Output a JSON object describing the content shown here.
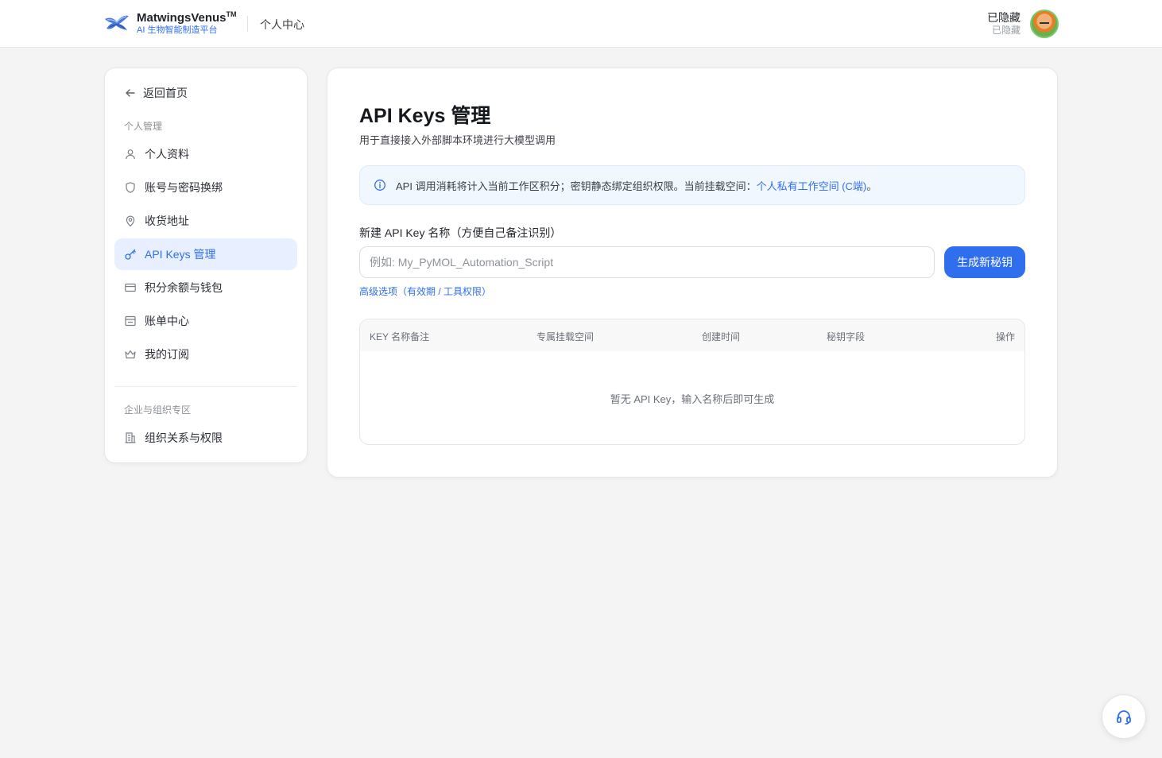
{
  "header": {
    "brand_name": "MatwingsVenus",
    "brand_tm": "TM",
    "brand_sub": "AI 生物智能制造平台",
    "section": "个人中心",
    "user_name": "已隐藏",
    "user_sub": "已隐藏"
  },
  "sidebar": {
    "back_label": "返回首页",
    "group_personal": "个人管理",
    "items": [
      {
        "label": "个人资料",
        "icon": "user-icon"
      },
      {
        "label": "账号与密码换绑",
        "icon": "shield-icon"
      },
      {
        "label": "收货地址",
        "icon": "location-pin-icon"
      },
      {
        "label": "API Keys 管理",
        "icon": "key-icon",
        "active": true
      },
      {
        "label": "积分余额与钱包",
        "icon": "card-icon"
      },
      {
        "label": "账单中心",
        "icon": "bill-icon"
      },
      {
        "label": "我的订阅",
        "icon": "crown-icon"
      }
    ],
    "group_org": "企业与组织专区",
    "org_items": [
      {
        "label": "组织关系与权限",
        "icon": "building-icon"
      }
    ]
  },
  "main": {
    "title": "API Keys 管理",
    "subtitle": "用于直接接入外部脚本环境进行大模型调用",
    "notice_text": "API 调用消耗将计入当前工作区积分；密钥静态绑定组织权限。当前挂载空间：",
    "notice_space": "个人私有工作空间 (C端)",
    "notice_end": "。",
    "field_label": "新建 API Key 名称（方便自己备注识别）",
    "input_placeholder": "例如: My_PyMOL_Automation_Script",
    "input_value": "",
    "generate_button": "生成新秘钥",
    "advanced_link": "高级选项（有效期 / 工具权限）",
    "table": {
      "columns": [
        "KEY 名称备注",
        "专属挂载空间",
        "创建时间",
        "秘钥字段",
        "操作"
      ],
      "empty_text": "暂无 API Key，输入名称后即可生成"
    }
  },
  "colors": {
    "accent": "#2f6fed",
    "background": "#f4f4f5",
    "notice_bg": "#f1f7fe"
  }
}
